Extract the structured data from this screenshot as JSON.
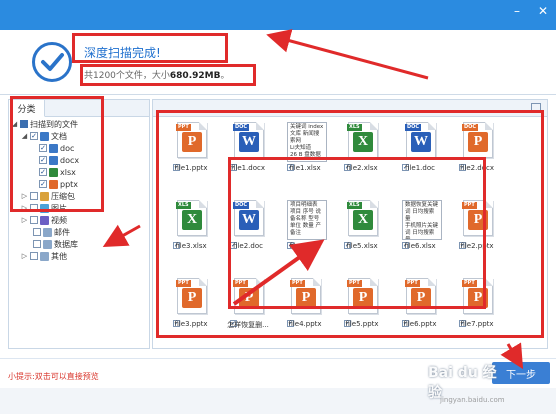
{
  "header": {
    "title": "深度扫描完成!",
    "summary_prefix": "共1200个文件，大小",
    "summary_size": "680.92MB",
    "summary_suffix": "。"
  },
  "sidebar": {
    "tab_label": "分类",
    "tree": {
      "root": "扫描到的文件",
      "documents": "文档",
      "doc": "doc",
      "docx": "docx",
      "xlsx": "xlsx",
      "pptx": "pptx",
      "archives": "压缩包",
      "images": "图片",
      "video": "视频",
      "email": "邮件",
      "database": "数据库",
      "other": "其他"
    }
  },
  "files": [
    {
      "name": "file1.pptx",
      "kind": "pptx"
    },
    {
      "name": "file1.docx",
      "kind": "docx"
    },
    {
      "name": "file1.xlsx",
      "kind": "preview",
      "preview": [
        "关键词 index",
        "文库 新闻搜",
        "索网",
        "Li夫知道",
        "26 B 盘数据"
      ]
    },
    {
      "name": "file2.xlsx",
      "kind": "xlsx"
    },
    {
      "name": "file1.doc",
      "kind": "doc"
    },
    {
      "name": "file2.docx",
      "kind": "docx2"
    },
    {
      "name": "file3.xlsx",
      "kind": "xlsx"
    },
    {
      "name": "file2.doc",
      "kind": "doc"
    },
    {
      "name": "file4.xlsx",
      "kind": "preview",
      "preview": [
        "项目明细表",
        "项目 序号 说",
        "备名称 型号",
        "单位 数量 产",
        "备注"
      ]
    },
    {
      "name": "file5.xlsx",
      "kind": "xlsx"
    },
    {
      "name": "file6.xlsx",
      "kind": "preview",
      "preview": [
        "数据恢复关键",
        "词 日均搜索量",
        "手机照片关键",
        "词 日均搜索量",
        "数据关键词"
      ]
    },
    {
      "name": "file2.pptx",
      "kind": "pptx"
    },
    {
      "name": "file3.pptx",
      "kind": "pptx"
    },
    {
      "name": "怎样恢复删...",
      "kind": "pptx"
    },
    {
      "name": "file4.pptx",
      "kind": "pptx"
    },
    {
      "name": "file5.pptx",
      "kind": "pptx"
    },
    {
      "name": "file6.pptx",
      "kind": "pptx"
    },
    {
      "name": "file7.pptx",
      "kind": "pptx"
    }
  ],
  "footer": {
    "tip": "小提示:双击可以直接预览",
    "next_button": "下一步"
  },
  "watermark": {
    "logo": "Bai du 经验",
    "url": "jingyan.baidu.com"
  },
  "colors": {
    "titlebar": "#2b8be0",
    "accent": "#1e6fce",
    "annotation": "#e02a2a",
    "pptx": "#e0692b",
    "docx": "#2a5fb8",
    "xlsx": "#2f8a3c"
  }
}
